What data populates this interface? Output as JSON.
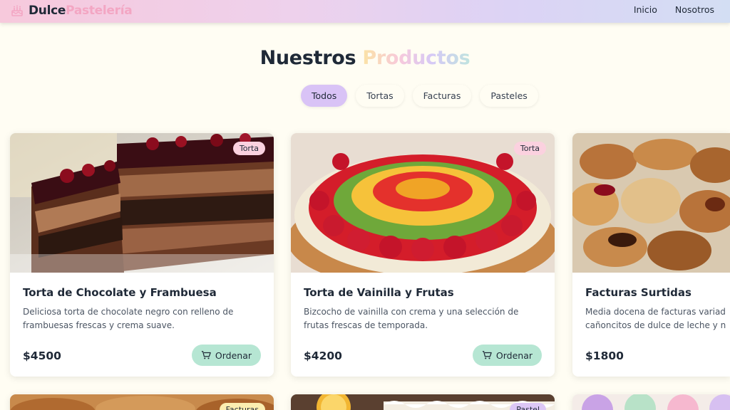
{
  "header": {
    "brand_primary": "Dulce",
    "brand_secondary": "Pastelería",
    "brand_icon": "cake-icon",
    "nav": [
      {
        "label": "Inicio"
      },
      {
        "label": "Nosotros"
      }
    ]
  },
  "section": {
    "title_primary": "Nuestros",
    "title_secondary": "Productos"
  },
  "filters": {
    "active": "Todos",
    "items": [
      {
        "label": "Todos"
      },
      {
        "label": "Tortas"
      },
      {
        "label": "Facturas"
      },
      {
        "label": "Pasteles"
      }
    ]
  },
  "products": [
    {
      "name": "Torta de Chocolate y Frambuesa",
      "badge": "Torta",
      "description_lines": [
        "Deliciosa torta de chocolate negro con relleno de",
        "frambuesas frescas y crema suave."
      ],
      "price": "$4500",
      "order_label": "Ordenar",
      "image": "chocolate-raspberry-cake-photo"
    },
    {
      "name": "Torta de Vainilla y Frutas",
      "badge": "Torta",
      "description_lines": [
        "Bizcocho de vainilla con crema y una selección de",
        "frutas frescas de temporada."
      ],
      "price": "$4200",
      "order_label": "Ordenar",
      "image": "fruit-tart-photo"
    },
    {
      "name": "Facturas Surtidas",
      "badge": "",
      "description_lines": [
        "Media docena de facturas variad",
        "cañoncitos de dulce de leche y n"
      ],
      "price": "$1800",
      "order_label": "",
      "image": "assorted-pastries-photo"
    },
    {
      "badge": "Facturas",
      "image": "croissants-photo"
    },
    {
      "badge": "Pastel",
      "image": "lemon-meringue-photo"
    },
    {
      "badge": "",
      "image": "cupcakes-photo"
    }
  ],
  "colors": {
    "accent_purple": "#d9c3f6",
    "order_green": "#b6e6d3",
    "badge_pink": "#fbd1df",
    "badge_yellow": "#fbeeb0",
    "brand_pink": "#f3a6c3",
    "background": "#fffdf3"
  }
}
